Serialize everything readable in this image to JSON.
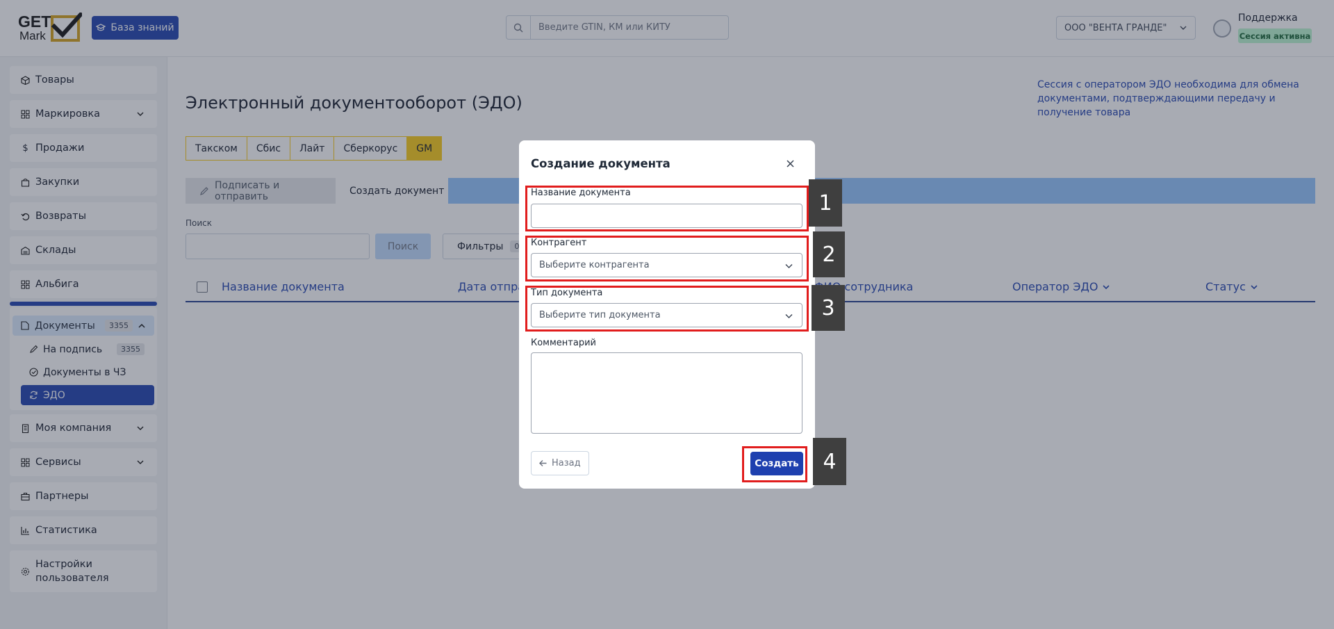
{
  "header": {
    "logo_top": "GET",
    "logo_bottom": "Mark",
    "kb_button": "База знаний",
    "search_placeholder": "Введите GTIN, КМ или КИТУ",
    "org_selected": "ООО \"ВЕНТА ГРАНДЕ\"",
    "support": "Поддержка",
    "session_badge": "Сессия активна"
  },
  "sidebar": {
    "items": [
      {
        "label": "Товары",
        "icon": "box-icon"
      },
      {
        "label": "Маркировка",
        "icon": "grid-icon"
      },
      {
        "label": "Продажи",
        "icon": "dollar-icon"
      },
      {
        "label": "Закупки",
        "icon": "bag-icon"
      },
      {
        "label": "Возвраты",
        "icon": "undo-icon"
      },
      {
        "label": "Склады",
        "icon": "warehouse-icon"
      },
      {
        "label": "Альбига",
        "icon": "grid-icon"
      },
      {
        "label": "Моя компания",
        "icon": "building-icon"
      },
      {
        "label": "Сервисы",
        "icon": "grid-icon"
      },
      {
        "label": "Партнеры",
        "icon": "briefcase-icon"
      },
      {
        "label": "Статистика",
        "icon": "chart-icon"
      },
      {
        "label": "Настройки пользователя",
        "icon": "gear-icon"
      }
    ],
    "documents": {
      "label": "Документы",
      "count": "3355",
      "sub": [
        {
          "label": "На подпись",
          "count": "3355"
        },
        {
          "label": "Документы в ЧЗ"
        },
        {
          "label": "ЭДО"
        }
      ]
    }
  },
  "main": {
    "title": "Электронный документооборот (ЭДО)",
    "help": "Сессия с оператором ЭДО необходима для обмена документами, подтверждающими передачу и получение товара",
    "tabs": [
      "Такском",
      "Сбис",
      "Лайт",
      "Сберкорус",
      "GM"
    ],
    "active_tab": "GM",
    "toolbar": {
      "sign": "Подписать и отправить",
      "create": "Создать документ"
    },
    "search_label": "Поиск",
    "search_button": "Поиск",
    "filters_label": "Фильтры",
    "filters_count": "0",
    "columns": [
      "Название документа",
      "Дата отправ",
      "ФИО сотрудника",
      "Оператор ЭДО",
      "Статус"
    ]
  },
  "modal": {
    "title": "Создание документа",
    "name_label": "Название документа",
    "counterparty_label": "Контрагент",
    "counterparty_placeholder": "Выберите контрагента",
    "type_label": "Тип документа",
    "type_placeholder": "Выберите тип документа",
    "comment_label": "Комментарий",
    "back_button": "Назад",
    "create_button": "Создать"
  },
  "annotations": [
    "1",
    "2",
    "3",
    "4"
  ],
  "colors": {
    "primary": "#1e40af",
    "tab_active": "#facc15",
    "highlight": "#e11d1d",
    "session_bg": "#bbf7d0"
  }
}
